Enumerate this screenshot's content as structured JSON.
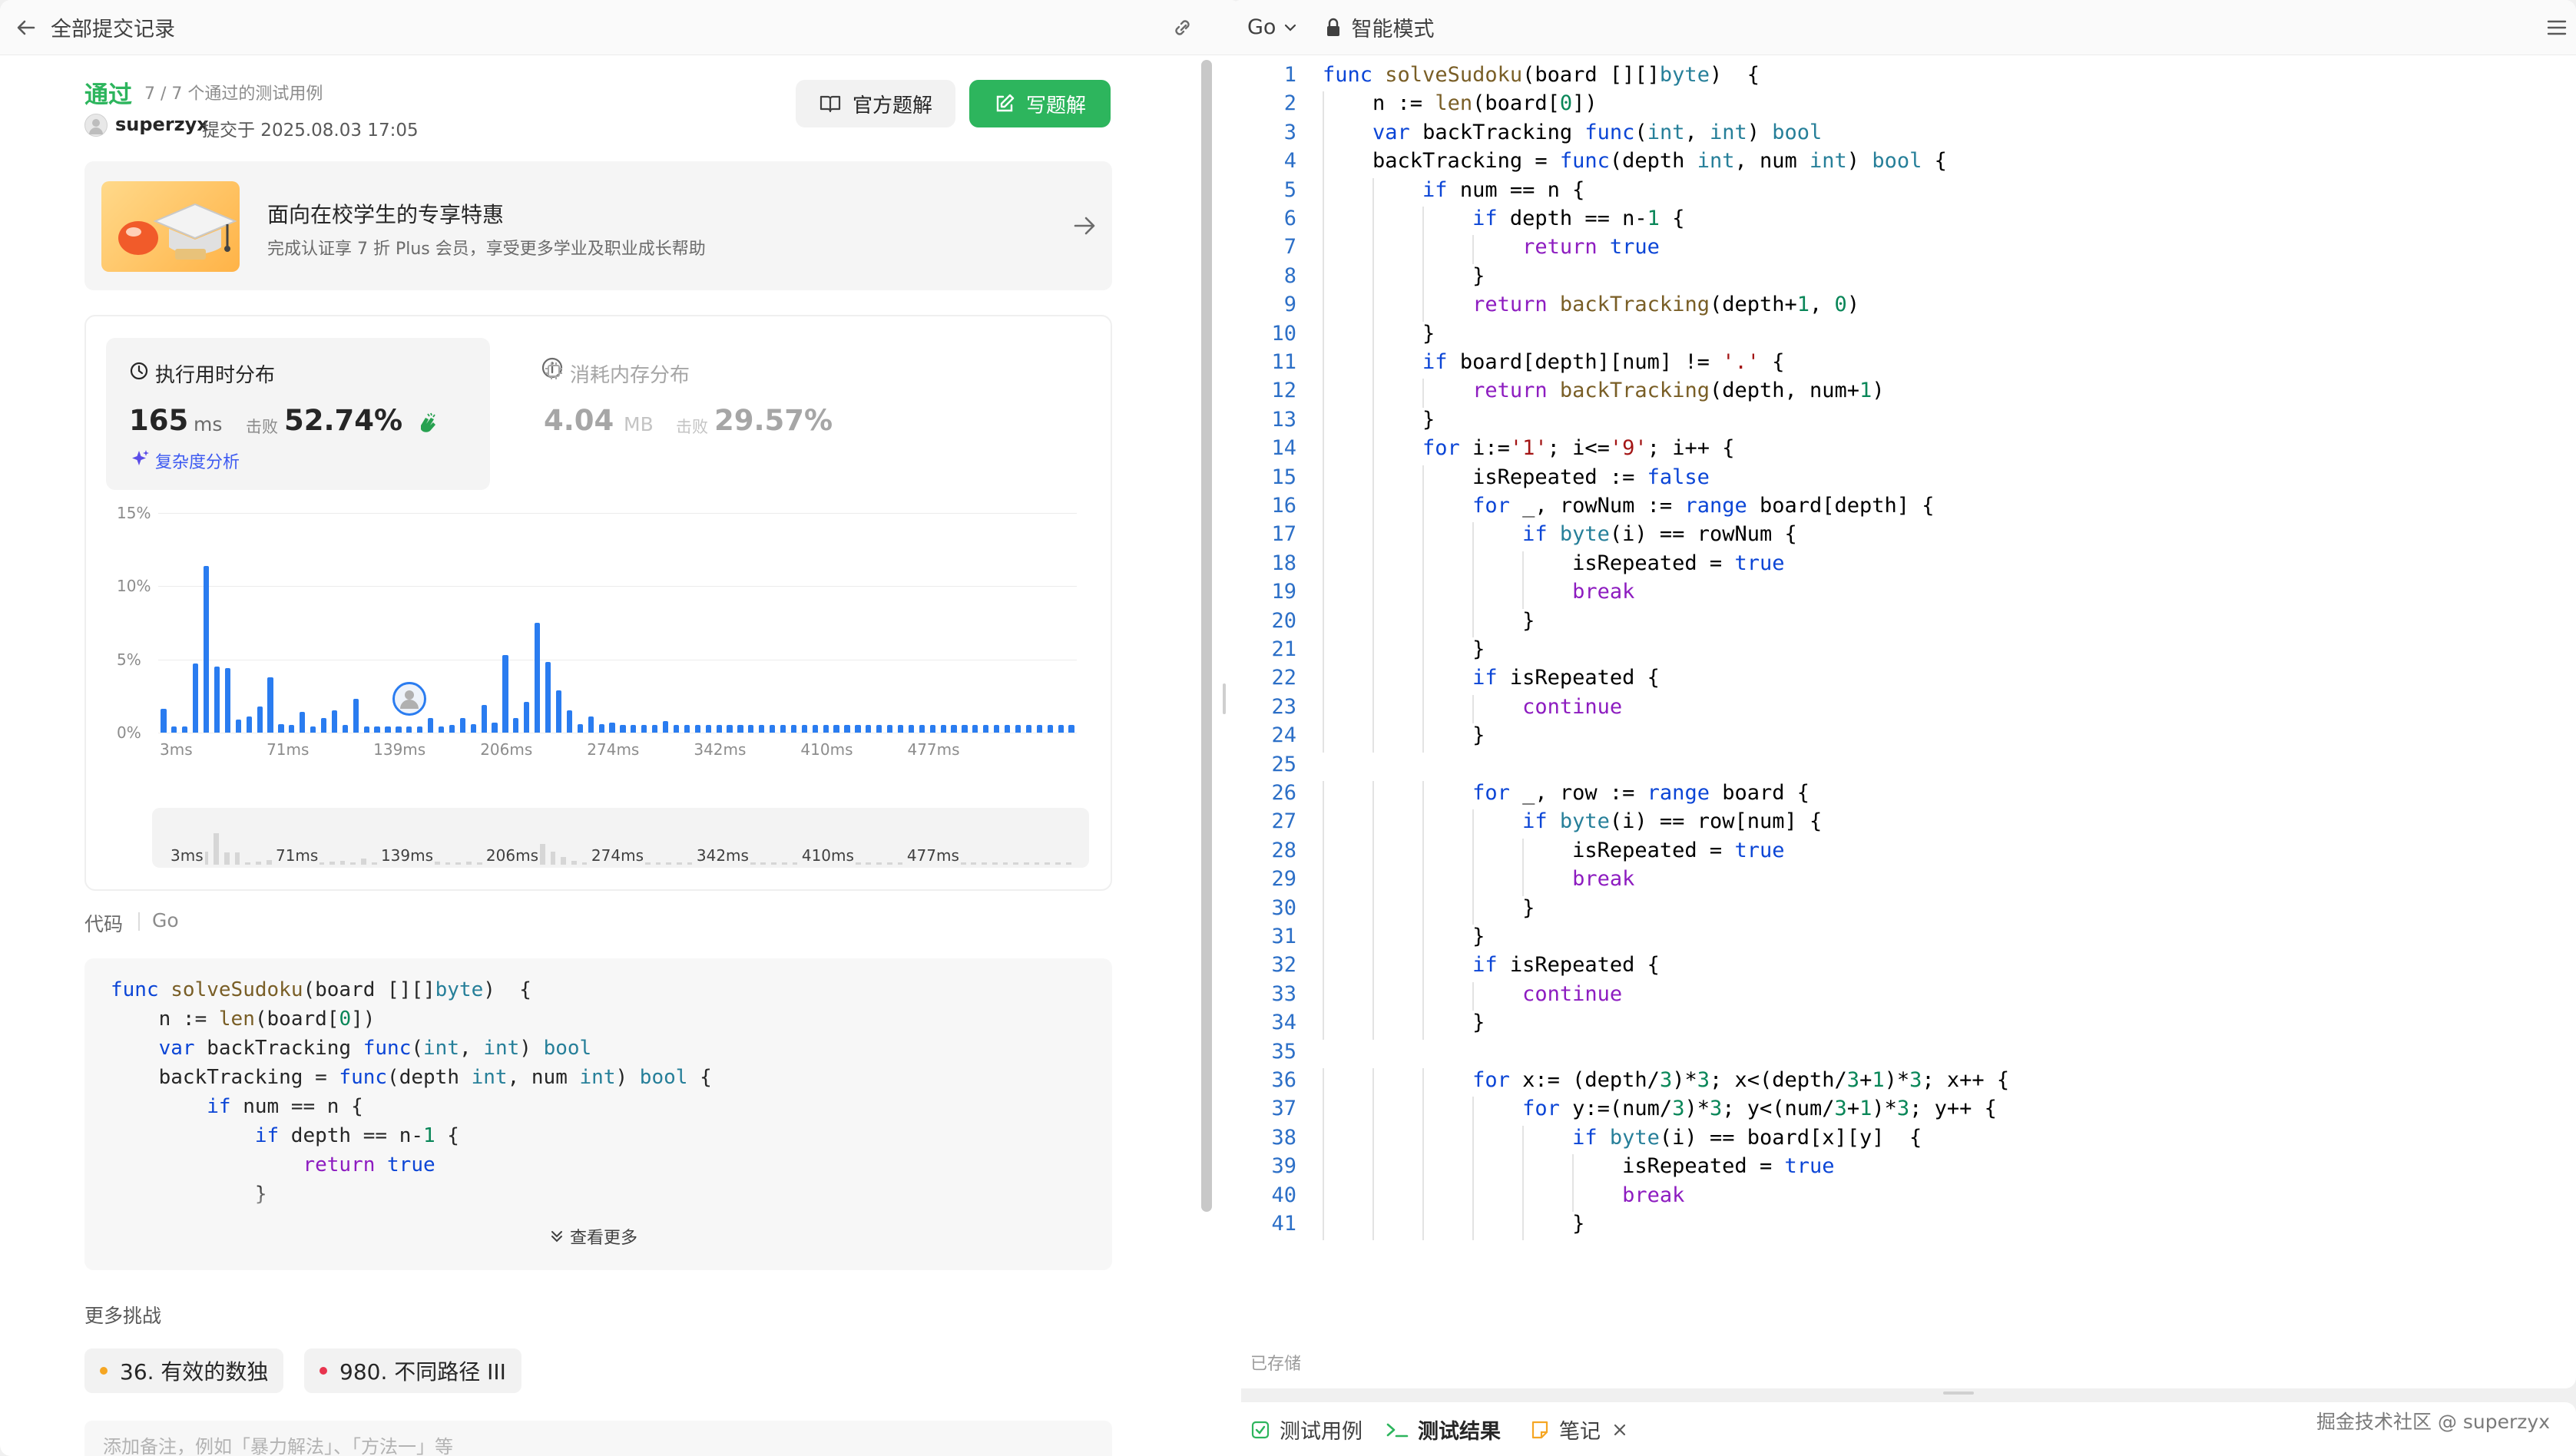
{
  "left_header": {
    "back_label": "全部提交记录"
  },
  "result": {
    "status": "通过",
    "tests": "7 / 7 个通过的测试用例",
    "user": "superzyx",
    "submitted": "提交于 2025.08.03 17:05",
    "official_btn": "官方题解",
    "write_btn": "写题解"
  },
  "promo": {
    "title": "面向在校学生的专享特惠",
    "desc": "完成认证享 7 折 Plus 会员，享受更多学业及职业成长帮助"
  },
  "stats": {
    "runtime_title": "执行用时分布",
    "runtime_value": "165",
    "runtime_unit": "ms",
    "beats_label": "击败",
    "runtime_beats": "52.74%",
    "complexity_link": "复杂度分析",
    "memory_title": "消耗内存分布",
    "memory_value": "4.04",
    "memory_unit": "MB",
    "memory_beats": "29.57%"
  },
  "chart_data": {
    "type": "bar",
    "y_ticks": [
      "15%",
      "10%",
      "5%",
      "0%"
    ],
    "ylim": [
      0,
      15
    ],
    "x_ticks": [
      "3ms",
      "71ms",
      "139ms",
      "206ms",
      "274ms",
      "342ms",
      "410ms",
      "477ms"
    ],
    "mini_x_ticks": [
      "3ms",
      "71ms",
      "139ms",
      "206ms",
      "274ms",
      "342ms",
      "410ms",
      "477ms"
    ],
    "values": [
      1.6,
      0.4,
      0.4,
      4.7,
      11.4,
      4.5,
      4.4,
      0.9,
      1.1,
      1.8,
      3.8,
      0.6,
      0.5,
      1.4,
      0.4,
      1.0,
      1.5,
      0.5,
      2.3,
      0.4,
      0.4,
      0.4,
      0.4,
      0.4,
      0.4,
      1.0,
      0.4,
      0.5,
      1.0,
      0.6,
      1.9,
      0.7,
      5.3,
      1.0,
      2.1,
      7.5,
      4.8,
      2.9,
      1.5,
      0.6,
      1.1,
      0.6,
      0.7,
      0.5,
      0.5,
      0.5,
      0.5,
      0.8,
      0.5,
      0.5,
      0.5,
      0.5,
      0.5,
      0.5,
      0.5,
      0.5,
      0.5,
      0.5,
      0.5,
      0.5,
      0.5,
      0.5,
      0.5,
      0.5,
      0.5,
      0.5,
      0.5,
      0.5,
      0.5,
      0.5,
      0.5,
      0.5,
      0.5,
      0.5,
      0.5,
      0.5,
      0.5,
      0.5,
      0.5,
      0.5,
      0.5,
      0.5,
      0.5,
      0.5,
      0.5,
      0.5
    ],
    "highlight_index": 23,
    "grid": true
  },
  "code_section": {
    "label": "代码",
    "lang": "Go",
    "expand": "查看更多"
  },
  "challenges": {
    "title": "更多挑战",
    "items": [
      {
        "label": "36. 有效的数独",
        "color": "#f5a623"
      },
      {
        "label": "980. 不同路径 III",
        "color": "#e8344e"
      }
    ]
  },
  "note_placeholder": "添加备注，例如「暴力解法」、「方法一」等",
  "editor": {
    "lang": "Go",
    "mode": "智能模式",
    "saved": "已存储"
  },
  "bottom_tabs": {
    "tab1": "测试用例",
    "tab2": "测试结果",
    "tab3": "笔记",
    "watermark": "掘金技术社区 @ superzyx"
  },
  "code_lines": [
    "func solveSudoku(board [][]byte)  {",
    "    n := len(board[0])",
    "    var backTracking func(int, int) bool",
    "    backTracking = func(depth int, num int) bool {",
    "        if num == n {",
    "            if depth == n-1 {",
    "                return true",
    "            }",
    "            return backTracking(depth+1, 0)",
    "        }",
    "        if board[depth][num] != '.' {",
    "            return backTracking(depth, num+1)",
    "        }",
    "        for i:='1'; i<='9'; i++ {",
    "            isRepeated := false",
    "            for _, rowNum := range board[depth] {",
    "                if byte(i) == rowNum {",
    "                    isRepeated = true",
    "                    break",
    "                }",
    "            }",
    "            if isRepeated {",
    "                continue",
    "            }",
    "",
    "            for _, row := range board {",
    "                if byte(i) == row[num] {",
    "                    isRepeated = true",
    "                    break",
    "                }",
    "            }",
    "            if isRepeated {",
    "                continue",
    "            }",
    "",
    "            for x:= (depth/3)*3; x<(depth/3+1)*3; x++ {",
    "                for y:=(num/3)*3; y<(num/3+1)*3; y++ {",
    "                    if byte(i) == board[x][y]  {",
    "                        isRepeated = true",
    "                        break",
    "                    }"
  ],
  "code_numbers": [
    "1",
    "2",
    "3",
    "4",
    "5",
    "6",
    "7",
    "8",
    "9",
    "10",
    "11",
    "12",
    "13",
    "14",
    "15",
    "16",
    "17",
    "18",
    "19",
    "20",
    "21",
    "22",
    "23",
    "24",
    "25",
    "26",
    "27",
    "28",
    "29",
    "30",
    "31",
    "32",
    "33",
    "34",
    "35",
    "36",
    "37",
    "38",
    "39",
    "40",
    "41"
  ],
  "preview_lines": [
    "func solveSudoku(board [][]byte)  {",
    "    n := len(board[0])",
    "    var backTracking func(int, int) bool",
    "    backTracking = func(depth int, num int) bool {",
    "        if num == n {",
    "            if depth == n-1 {",
    "                return true",
    "            }"
  ]
}
